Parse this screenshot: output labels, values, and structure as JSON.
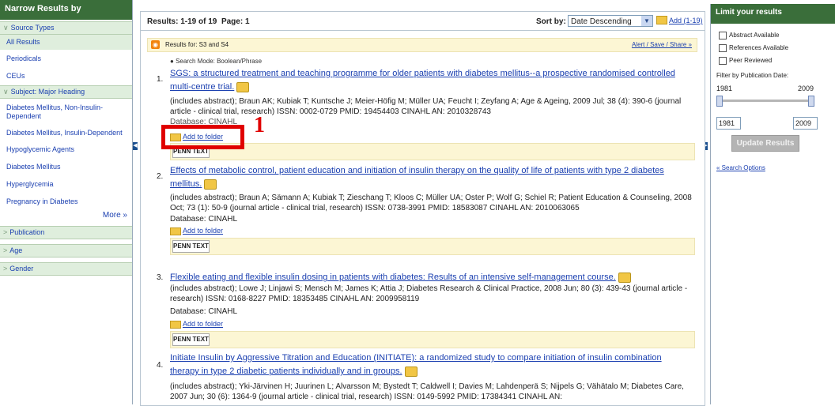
{
  "left_sidebar": {
    "title": "Narrow Results by",
    "source_types": "Source Types",
    "items": [
      "All Results",
      "Periodicals",
      "CEUs"
    ],
    "subject_heading": "Subject: Major Heading",
    "subjects": [
      "Diabetes Mellitus, Non-Insulin-Dependent",
      "Diabetes Mellitus, Insulin-Dependent",
      "Hypoglycemic Agents",
      "Diabetes Mellitus",
      "Hyperglycemia",
      "Pregnancy in Diabetes"
    ],
    "more": "More »",
    "facets": [
      "Publication",
      "Age",
      "Gender"
    ]
  },
  "results_bar": {
    "count": "Results: 1-19 of 19",
    "page": "Page: 1",
    "sort_label": "Sort by:",
    "sort_value": "Date Descending",
    "add_link": "Add (1-19)"
  },
  "rss": {
    "text": "Results for: S3 and S4",
    "alert": "Alert / Save / Share »"
  },
  "search_mode": "Search Mode: Boolean/Phrase",
  "results": [
    {
      "num": "1.",
      "title": "SGS: a structured treatment and teaching programme for older patients with diabetes mellitus--a prospective randomised controlled multi-centre trial.",
      "meta": "(includes abstract); Braun AK; Kubiak T; Kuntsche J; Meier-Höfig M; Müller UA; Feucht I; Zeyfang A; Age & Ageing, 2009 Jul; 38 (4): 390-6 (journal article - clinical trial, research) ISSN: 0002-0729 PMID: 19454403 CINAHL AN: 2010328743",
      "db": "Database: CINAHL",
      "add": "Add to folder",
      "penn": "PENN TEXT"
    },
    {
      "num": "2.",
      "title": "Effects of metabolic control, patient education and initiation of insulin therapy on the quality of life of patients with type 2 diabetes mellitus.",
      "meta": "(includes abstract); Braun A; Sämann A; Kubiak T; Zieschang T; Kloos C; Müller UA; Oster P; Wolf G; Schiel R; Patient Education & Counseling, 2008 Oct; 73 (1): 50-9 (journal article - clinical trial, research) ISSN: 0738-3991 PMID: 18583087 CINAHL AN: 2010063065",
      "db": "Database: CINAHL",
      "add": "Add to folder",
      "penn": "PENN TEXT"
    },
    {
      "num": "3.",
      "title": "Flexible eating and flexible insulin dosing in patients with diabetes: Results of an intensive self-management course.",
      "meta": "(includes abstract); Lowe J; Linjawi S; Mensch M; James K; Attia J; Diabetes Research & Clinical Practice, 2008 Jun; 80 (3): 439-43 (journal article - research) ISSN: 0168-8227 PMID: 18353485 CINAHL AN: 2009958119",
      "db": "Database: CINAHL",
      "add": "Add to folder",
      "penn": "PENN TEXT"
    },
    {
      "num": "4.",
      "title": "Initiate Insulin by Aggressive Titration and Education (INITIATE): a randomized study to compare initiation of insulin combination therapy in type 2 diabetic patients individually and in groups.",
      "meta": "(includes abstract); Yki-Järvinen H; Juurinen L; Alvarsson M; Bystedt T; Caldwell I; Davies M; Lahdenperä S; Nijpels G; Vähätalo M; Diabetes Care, 2007 Jun; 30 (6): 1364-9 (journal article - clinical trial, research) ISSN: 0149-5992 PMID: 17384341 CINAHL AN:"
    }
  ],
  "annotation": "1",
  "right_sidebar": {
    "title": "Limit your results",
    "checks": [
      "Abstract Available",
      "References Available",
      "Peer Reviewed"
    ],
    "pub_label": "Filter by Publication Date:",
    "year_from": "1981",
    "year_to": "2009",
    "update": "Update Results",
    "options": "« Search Options"
  }
}
